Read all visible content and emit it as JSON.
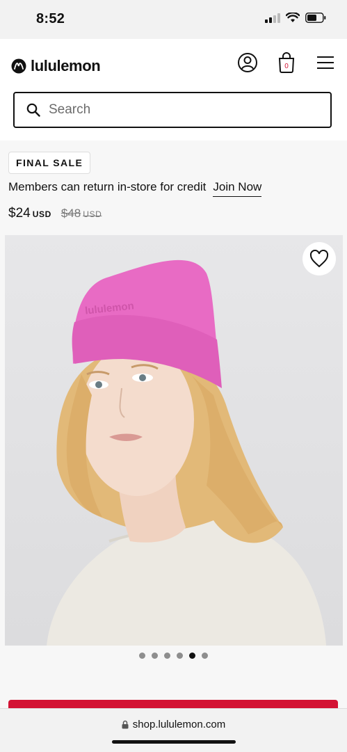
{
  "status": {
    "time": "8:52"
  },
  "header": {
    "brand": "lululemon",
    "bag_count": "0"
  },
  "search": {
    "placeholder": "Search"
  },
  "promo": {
    "badge": "FINAL SALE",
    "members_text": "Members can return in-store for credit",
    "join_link": "Join Now"
  },
  "price": {
    "current": "$24",
    "currency": "USD",
    "original": "$48",
    "original_currency": "USD"
  },
  "carousel": {
    "slide_count": 6,
    "active_index": 4
  },
  "browser": {
    "url": "shop.lululemon.com"
  },
  "colors": {
    "beanie": "#e86bc4",
    "accent": "#d31334"
  }
}
